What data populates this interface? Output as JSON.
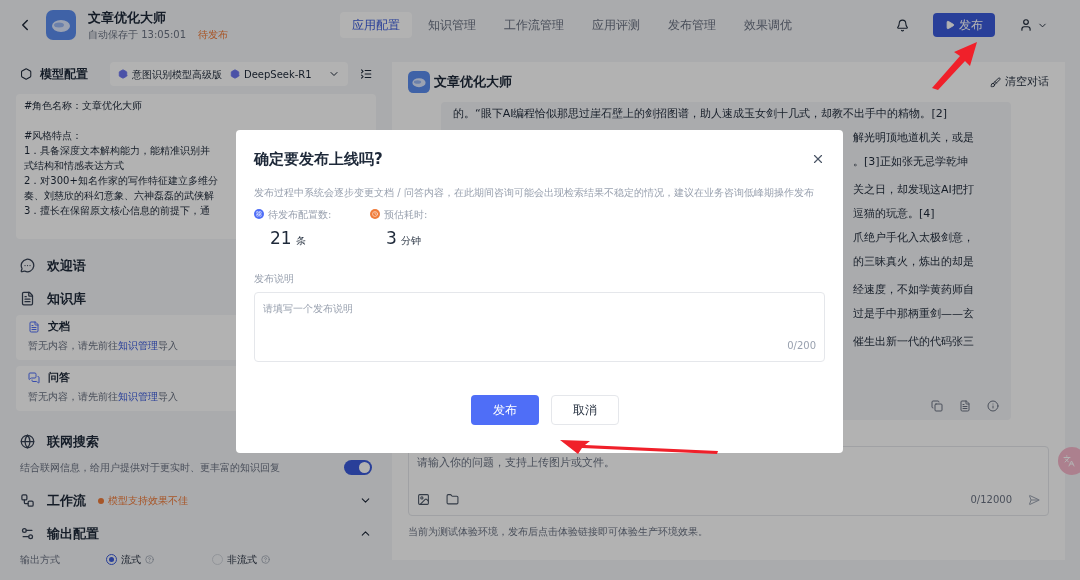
{
  "header": {
    "title": "文章优化大师",
    "autosave": "自动保存于 13:05:01",
    "status": "待发布",
    "tabs": [
      {
        "label": "应用配置",
        "selected": true
      },
      {
        "label": "知识管理",
        "selected": false
      },
      {
        "label": "工作流管理",
        "selected": false
      },
      {
        "label": "应用评测",
        "selected": false
      },
      {
        "label": "发布管理",
        "selected": false
      },
      {
        "label": "效果调优",
        "selected": false
      }
    ],
    "publish_button": "发布"
  },
  "config": {
    "model": {
      "title": "模型配置",
      "chips": [
        "意图识别模型高级版",
        "DeepSeek-R1"
      ]
    },
    "prompt_paragraphs": [
      [
        "#角色名称：文章优化大师"
      ],
      [
        "#风格特点：",
        "1．具备深度文本解构能力，能精准识别并",
        "式结构和情感表达方式",
        "2．对300+知名作家的写作特征建立多维分",
        "奏、刘慈欣的科幻意象、六神磊磊的武侠解",
        "3．擅长在保留原文核心信息的前提下，通"
      ]
    ],
    "welcome": {
      "title": "欢迎语"
    },
    "knowledge": {
      "title": "知识库",
      "items": [
        {
          "kind": "doc",
          "title": "文档",
          "hint_before": "暂无内容，请先前往",
          "link": "知识管理",
          "hint_after": "导入"
        },
        {
          "kind": "qa",
          "title": "问答",
          "hint_before": "暂无内容，请先前往",
          "link": "知识管理",
          "hint_after": "导入"
        }
      ]
    },
    "web_search": {
      "title": "联网搜索",
      "description": "结合联网信息，给用户提供对于更实时、更丰富的知识回复",
      "on": true
    },
    "workflow": {
      "title": "工作流",
      "warning": "模型支持效果不佳",
      "expanded": false
    },
    "output": {
      "title": "输出配置",
      "expanded": true,
      "label": "输出方式",
      "options": [
        {
          "label": "流式",
          "selected": true
        },
        {
          "label": "非流式",
          "selected": false
        }
      ]
    }
  },
  "chat": {
    "bot_name": "文章优化大师",
    "clear_button": "清空对话",
    "first_line": "的。“眼下AI编程恰似那思过崖石壁上的剑招图谱，助人速成玉女剑十几式，却教不出手中的精物。[2]",
    "paragraphs": [
      [
        "解光明顶地道机关，或是",
        "。[3]正如张无忌学乾坤"
      ],
      [
        "关之日，却发现这AI把打",
        "逗猫的玩意。[4]",
        "爪绝户手化入太极剑意，",
        "的三昧真火，炼出的却是"
      ],
      [
        "经速度，不如学黄药师自",
        "过是手中那柄重剑——玄"
      ],
      [
        "催生出新一代的代码张三"
      ]
    ],
    "input_placeholder": "请输入你的问题，支持上传图片或文件。",
    "counter": "0/12000",
    "footer": "当前为测试体验环境，发布后点击体验链接即可体验生产环境效果。"
  },
  "dialog": {
    "title": "确定要发布上线吗?",
    "description": "发布过程中系统会逐步变更文档 / 问答内容，在此期间咨询可能会出现检索结果不稳定的情况，建议在业务咨询低峰期操作发布",
    "stats": [
      {
        "kind": "count",
        "label": "待发布配置数:",
        "value": "21",
        "unit": "条"
      },
      {
        "kind": "time",
        "label": "预估耗时:",
        "value": "3",
        "unit": "分钟"
      }
    ],
    "notes_label": "发布说明",
    "notes_placeholder": "请填写一个发布说明",
    "notes_counter": "0/200",
    "confirm": "发布",
    "cancel": "取消"
  }
}
